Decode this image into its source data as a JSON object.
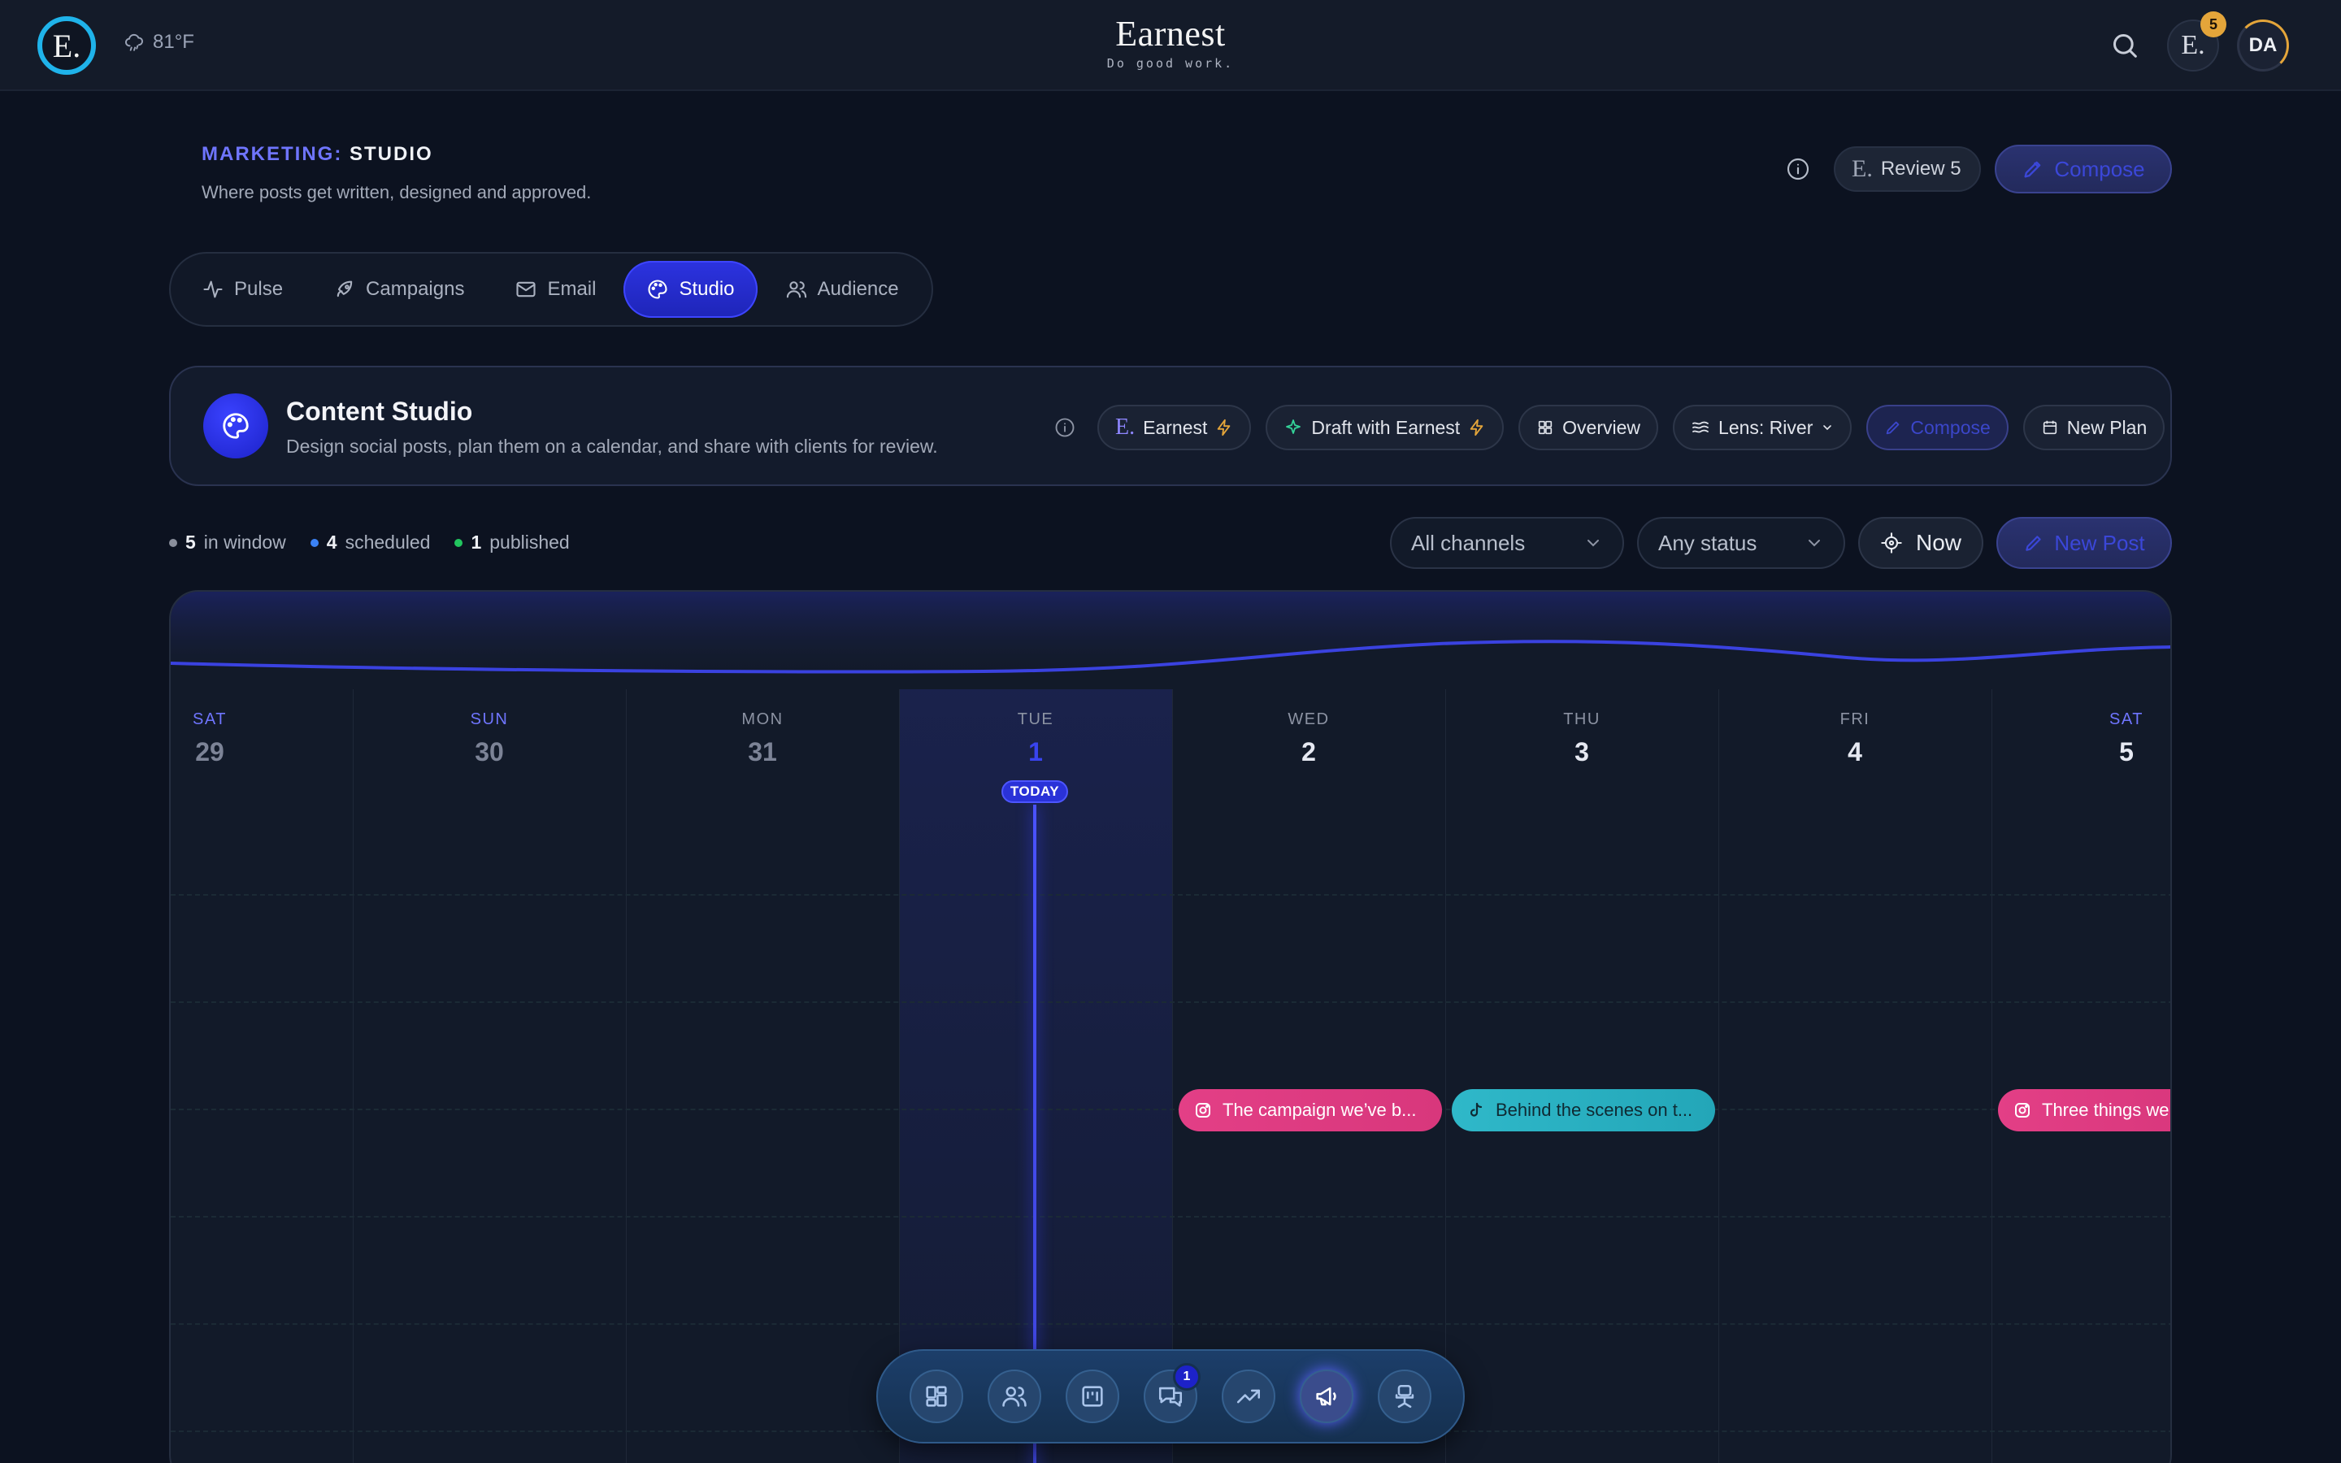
{
  "topbar": {
    "logo_letter": "E.",
    "weather": "81°F",
    "brand_title": "Earnest",
    "brand_tagline": "Do good work.",
    "notifications_count": "5",
    "avatar_initials": "DA"
  },
  "header": {
    "crumb_section": "MARKETING:",
    "crumb_page": "STUDIO",
    "subtitle": "Where posts get written, designed and approved.",
    "review_label": "Review 5",
    "compose_label": "Compose"
  },
  "tabs": [
    {
      "label": "Pulse",
      "icon": "activity-icon",
      "active": false
    },
    {
      "label": "Campaigns",
      "icon": "rocket-icon",
      "active": false
    },
    {
      "label": "Email",
      "icon": "mail-icon",
      "active": false
    },
    {
      "label": "Studio",
      "icon": "palette-icon",
      "active": true
    },
    {
      "label": "Audience",
      "icon": "users-icon",
      "active": false
    }
  ],
  "studio": {
    "title": "Content Studio",
    "subtitle": "Design social posts, plan them on a calendar, and share with clients for review.",
    "chips": {
      "earnest": "Earnest",
      "draft": "Draft with Earnest",
      "overview": "Overview",
      "lens": "Lens: River",
      "compose": "Compose",
      "new_plan": "New Plan"
    }
  },
  "stats": [
    {
      "value": "5",
      "label": "in window",
      "color": "#8a8f9c"
    },
    {
      "value": "4",
      "label": "scheduled",
      "color": "#3b82f6"
    },
    {
      "value": "1",
      "label": "published",
      "color": "#22c55e"
    }
  ],
  "filters": {
    "channels": "All channels",
    "status": "Any status",
    "now": "Now",
    "new_post": "New Post"
  },
  "calendar": {
    "today_label": "TODAY",
    "days": [
      {
        "dow": "SAT",
        "num": "29"
      },
      {
        "dow": "SUN",
        "num": "30"
      },
      {
        "dow": "MON",
        "num": "31"
      },
      {
        "dow": "TUE",
        "num": "1"
      },
      {
        "dow": "WED",
        "num": "2"
      },
      {
        "dow": "THU",
        "num": "3"
      },
      {
        "dow": "FRI",
        "num": "4"
      },
      {
        "dow": "SAT",
        "num": "5"
      }
    ],
    "posts": [
      {
        "text": "The campaign we’ve b...",
        "channel": "instagram"
      },
      {
        "text": "Behind the scenes on t...",
        "channel": "tiktok"
      },
      {
        "text": "Three things we",
        "channel": "instagram"
      }
    ]
  },
  "dock": {
    "items": [
      "dashboard-icon",
      "people-icon",
      "board-icon",
      "chat-icon",
      "trend-icon",
      "megaphone-icon",
      "chair-icon"
    ],
    "chat_badge": "1"
  },
  "colors": {
    "accent": "#2c33e0",
    "brand_ring": "#1fb3ea",
    "instagram": "#e33f86",
    "tiktok": "#2fb8c9"
  }
}
